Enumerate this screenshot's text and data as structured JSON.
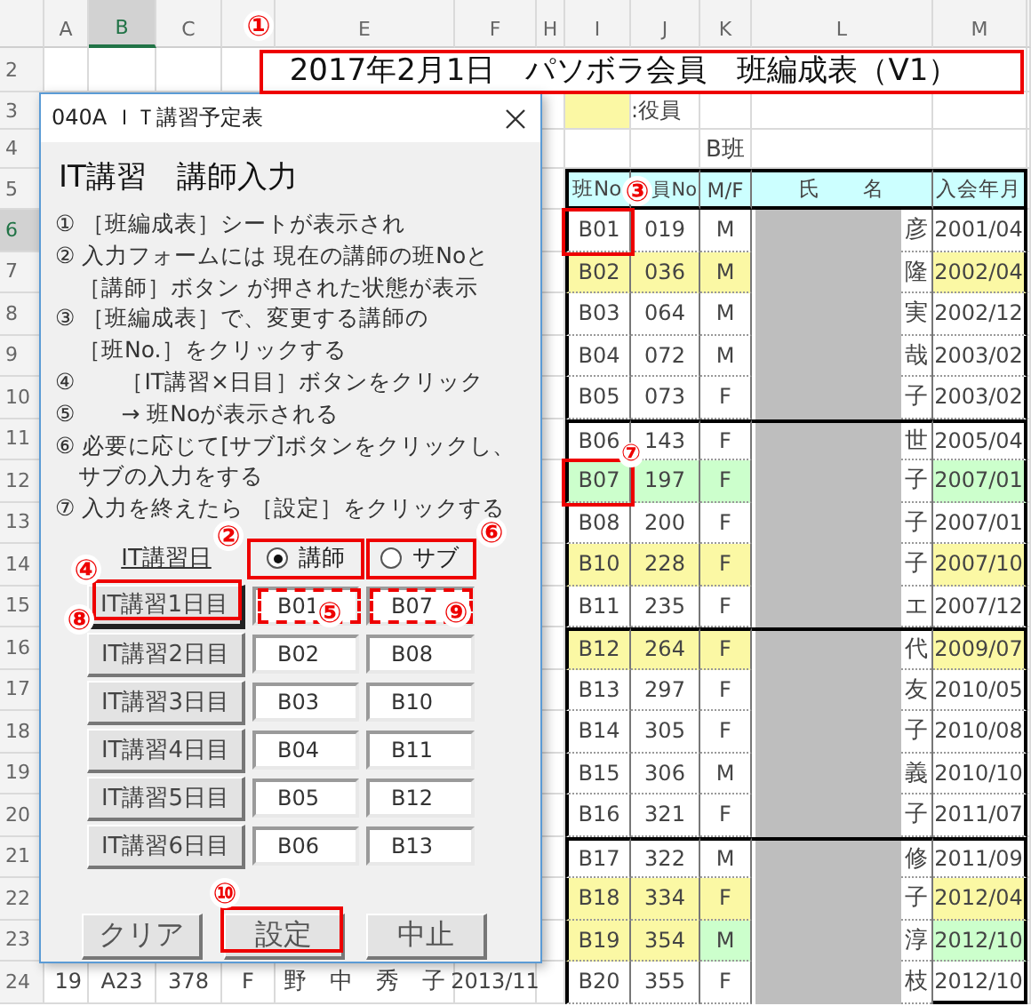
{
  "sheet": {
    "columns": [
      {
        "label": "A",
        "selected": false
      },
      {
        "label": "B",
        "selected": true
      },
      {
        "label": "C",
        "selected": false
      },
      {
        "label": "E",
        "selected": false
      },
      {
        "label": "F",
        "selected": false
      },
      {
        "label": "H",
        "selected": false
      },
      {
        "label": "I",
        "selected": false
      },
      {
        "label": "J",
        "selected": false
      },
      {
        "label": "K",
        "selected": false
      },
      {
        "label": "L",
        "selected": false
      },
      {
        "label": "M",
        "selected": false
      }
    ],
    "row_headers": [
      {
        "label": "2",
        "selected": false
      },
      {
        "label": "3",
        "selected": false
      },
      {
        "label": "4",
        "selected": false
      },
      {
        "label": "5",
        "selected": false
      },
      {
        "label": "6",
        "selected": true
      },
      {
        "label": "7",
        "selected": false
      },
      {
        "label": "8",
        "selected": false
      },
      {
        "label": "9",
        "selected": false
      },
      {
        "label": "10",
        "selected": false
      },
      {
        "label": "11",
        "selected": false
      },
      {
        "label": "12",
        "selected": false
      },
      {
        "label": "13",
        "selected": false
      },
      {
        "label": "14",
        "selected": false
      },
      {
        "label": "15",
        "selected": false
      },
      {
        "label": "16",
        "selected": false
      },
      {
        "label": "17",
        "selected": false
      },
      {
        "label": "18",
        "selected": false
      },
      {
        "label": "19",
        "selected": false
      },
      {
        "label": "20",
        "selected": false
      },
      {
        "label": "21",
        "selected": false
      },
      {
        "label": "22",
        "selected": false
      },
      {
        "label": "23",
        "selected": false
      },
      {
        "label": "24",
        "selected": false
      }
    ],
    "title": "2017年2月1日　パソボラ会員　班編成表（V1）",
    "legend": {
      "text": ":役員"
    },
    "group_label": "B班",
    "table": {
      "headers": [
        "班No",
        "員No",
        "M/F",
        "氏　　名",
        "入会年月"
      ],
      "groups": [
        {
          "rows": [
            {
              "no": "B01",
              "member_no": "019",
              "mf": "M",
              "name_visible": "彦",
              "joined": "2001/04",
              "kind": "plain"
            },
            {
              "no": "B02",
              "member_no": "036",
              "mf": "M",
              "name_visible": "隆",
              "joined": "2002/04",
              "kind": "officer"
            },
            {
              "no": "B03",
              "member_no": "064",
              "mf": "M",
              "name_visible": "実",
              "joined": "2002/12",
              "kind": "plain"
            },
            {
              "no": "B04",
              "member_no": "072",
              "mf": "M",
              "name_visible": "哉",
              "joined": "2003/02",
              "kind": "plain"
            },
            {
              "no": "B05",
              "member_no": "073",
              "mf": "F",
              "name_visible": "子",
              "joined": "2003/02",
              "kind": "plain"
            }
          ]
        },
        {
          "rows": [
            {
              "no": "B06",
              "member_no": "143",
              "mf": "F",
              "name_visible": "世",
              "joined": "2005/04",
              "kind": "plain"
            },
            {
              "no": "B07",
              "member_no": "197",
              "mf": "F",
              "name_visible": "子",
              "joined": "2007/01",
              "kind": "new"
            },
            {
              "no": "B08",
              "member_no": "200",
              "mf": "F",
              "name_visible": "子",
              "joined": "2007/01",
              "kind": "plain"
            },
            {
              "no": "B10",
              "member_no": "228",
              "mf": "F",
              "name_visible": "子",
              "joined": "2007/10",
              "kind": "officer"
            },
            {
              "no": "B11",
              "member_no": "235",
              "mf": "F",
              "name_visible": "エ",
              "joined": "2007/12",
              "kind": "plain"
            }
          ]
        },
        {
          "rows": [
            {
              "no": "B12",
              "member_no": "264",
              "mf": "F",
              "name_visible": "代",
              "joined": "2009/07",
              "kind": "officer"
            },
            {
              "no": "B13",
              "member_no": "297",
              "mf": "F",
              "name_visible": "友",
              "joined": "2010/05",
              "kind": "plain"
            },
            {
              "no": "B14",
              "member_no": "305",
              "mf": "F",
              "name_visible": "子",
              "joined": "2010/08",
              "kind": "plain"
            },
            {
              "no": "B15",
              "member_no": "306",
              "mf": "M",
              "name_visible": "義",
              "joined": "2010/10",
              "kind": "plain"
            },
            {
              "no": "B16",
              "member_no": "321",
              "mf": "F",
              "name_visible": "子",
              "joined": "2011/07",
              "kind": "plain"
            }
          ]
        },
        {
          "rows": [
            {
              "no": "B17",
              "member_no": "322",
              "mf": "M",
              "name_visible": "修",
              "joined": "2011/09",
              "kind": "plain"
            },
            {
              "no": "B18",
              "member_no": "334",
              "mf": "F",
              "name_visible": "子",
              "joined": "2012/04",
              "kind": "officer"
            },
            {
              "no": "B19",
              "member_no": "354",
              "mf": "M",
              "name_visible": "淳",
              "joined": "2012/10",
              "kind": "officer_new"
            },
            {
              "no": "B20",
              "member_no": "355",
              "mf": "F",
              "name_visible": "枝",
              "joined": "2012/10",
              "kind": "plain"
            }
          ]
        }
      ]
    },
    "left_row": {
      "index": "19",
      "id": "A23",
      "member_no": "378",
      "mf": "F",
      "name": "野　中　秀　子",
      "joined": "2013/11"
    }
  },
  "dialog": {
    "title": "040A ＩＴ講習予定表",
    "heading": "IT講習　講師入力",
    "instructions": [
      "① ［班編成表］シートが表示され",
      "② 入力フォームには 現在の講師の班Noと",
      "　［講師］ボタン が押された状態が表示",
      "③ ［班編成表］で、変更する講師の",
      "　［班No.］をクリックする",
      "④　　［IT講習×日目］ボタンをクリック",
      "⑤　　→ 班Noが表示される",
      "⑥ 必要に応じて[サブ]ボタンをクリックし、",
      "　サブの入力をする",
      "⑦ 入力を終えたら ［設定］をクリックする"
    ],
    "date_label": "IT講習日",
    "radios": [
      {
        "label": "講師",
        "selected": true
      },
      {
        "label": "サブ",
        "selected": false
      }
    ],
    "days": [
      {
        "label": "IT講習1日目",
        "selected": true,
        "instructor": "B01",
        "sub": "B07"
      },
      {
        "label": "IT講習2日目",
        "selected": false,
        "instructor": "B02",
        "sub": "B08"
      },
      {
        "label": "IT講習3日目",
        "selected": false,
        "instructor": "B03",
        "sub": "B10"
      },
      {
        "label": "IT講習4日目",
        "selected": false,
        "instructor": "B04",
        "sub": "B11"
      },
      {
        "label": "IT講習5日目",
        "selected": false,
        "instructor": "B05",
        "sub": "B12"
      },
      {
        "label": "IT講習6日目",
        "selected": false,
        "instructor": "B06",
        "sub": "B13"
      }
    ],
    "buttons": [
      "クリア",
      "設定",
      "中止"
    ]
  },
  "annotations": [
    {
      "label": "①",
      "kind": "solid"
    },
    {
      "label": "②",
      "kind": "solid"
    },
    {
      "label": "③",
      "kind": "solid"
    },
    {
      "label": "④",
      "kind": "solid"
    },
    {
      "label": "⑤",
      "kind": "dashed"
    },
    {
      "label": "⑥",
      "kind": "solid"
    },
    {
      "label": "⑦",
      "kind": "solid"
    },
    {
      "label": "⑧",
      "kind": "plain"
    },
    {
      "label": "⑨",
      "kind": "dashed"
    },
    {
      "label": "⑩",
      "kind": "solid"
    }
  ]
}
